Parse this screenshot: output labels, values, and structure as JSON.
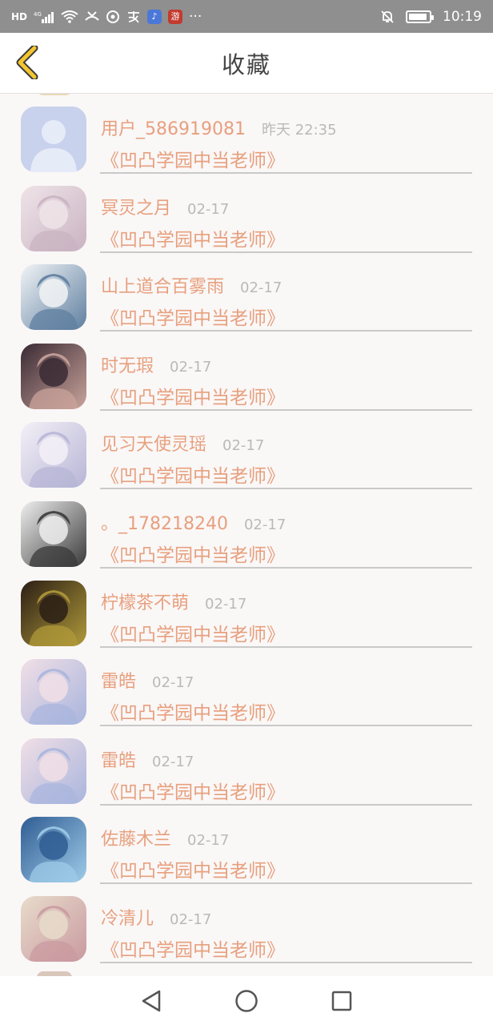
{
  "statusbar": {
    "network": "HD",
    "signal_label": "4G",
    "time": "10:19",
    "app_badge_1": "♪",
    "app_badge_2": "游",
    "more": "···"
  },
  "header": {
    "title": "收藏"
  },
  "items": [
    {
      "name": "用户_586919081",
      "time": "昨天 22:35",
      "title": "《凹凸学园中当老师》",
      "avatar_colors": [
        "#c8d2ec",
        "#dfe5f5"
      ]
    },
    {
      "name": "冥灵之月",
      "time": "02-17",
      "title": "《凹凸学园中当老师》",
      "avatar_colors": [
        "#efe4e8",
        "#c9b3c2"
      ]
    },
    {
      "name": "山上道合百雾雨",
      "time": "02-17",
      "title": "《凹凸学园中当老师》",
      "avatar_colors": [
        "#f2f4f6",
        "#5f7fa0"
      ]
    },
    {
      "name": "时无瑕",
      "time": "02-17",
      "title": "《凹凸学园中当老师》",
      "avatar_colors": [
        "#3a2a34",
        "#c9a39b"
      ]
    },
    {
      "name": "见习天使灵瑶",
      "time": "02-17",
      "title": "《凹凸学园中当老师》",
      "avatar_colors": [
        "#f4f0f7",
        "#b7b5d6"
      ]
    },
    {
      "name": "。_178218240",
      "time": "02-17",
      "title": "《凹凸学园中当老师》",
      "avatar_colors": [
        "#efefef",
        "#3a3a3a"
      ]
    },
    {
      "name": "柠檬茶不萌",
      "time": "02-17",
      "title": "《凹凸学园中当老师》",
      "avatar_colors": [
        "#2b1e15",
        "#b09a3a"
      ]
    },
    {
      "name": "雷皓",
      "time": "02-17",
      "title": "《凹凸学园中当老师》",
      "avatar_colors": [
        "#f1dfe6",
        "#a9b5dd"
      ]
    },
    {
      "name": "雷皓",
      "time": "02-17",
      "title": "《凹凸学园中当老师》",
      "avatar_colors": [
        "#f1dfe6",
        "#a9b5dd"
      ]
    },
    {
      "name": "佐藤木兰",
      "time": "02-17",
      "title": "《凹凸学园中当老师》",
      "avatar_colors": [
        "#2f5d93",
        "#9fcbe8"
      ]
    },
    {
      "name": "冷清儿",
      "time": "02-17",
      "title": "《凹凸学园中当老师》",
      "avatar_colors": [
        "#e8dccb",
        "#c99aa0"
      ]
    }
  ],
  "colors": {
    "accent_text": "#e7a07e",
    "time_text": "#b9b9b9",
    "back_chevron": "#f2c531"
  }
}
